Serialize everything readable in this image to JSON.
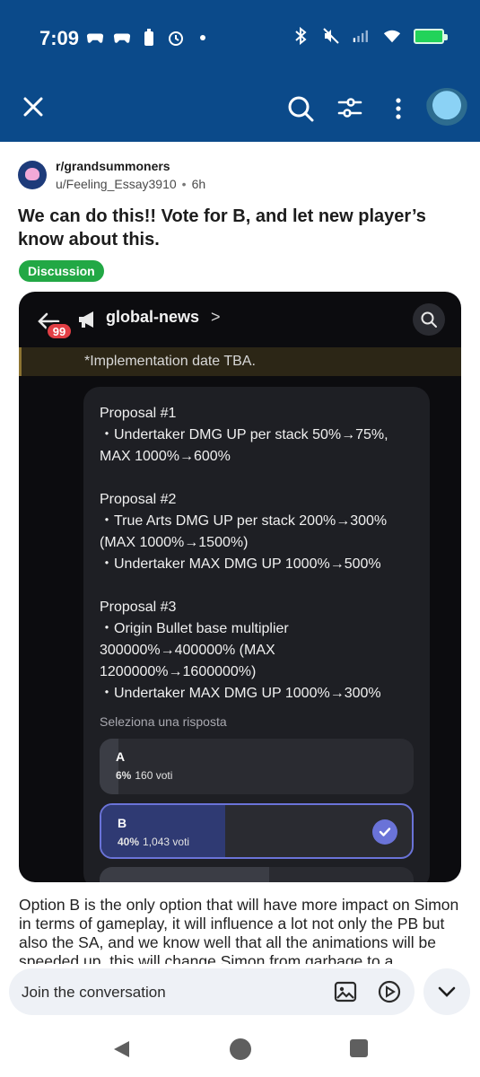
{
  "status_bar": {
    "time": "7:09",
    "left_icons": [
      "game-controller-icon",
      "game-controller-icon",
      "battery-saver-icon",
      "alarm-icon",
      "dot-icon"
    ],
    "right_icons": [
      "bluetooth-icon",
      "mute-icon",
      "signal-icon",
      "wifi-icon",
      "battery-charging-icon"
    ]
  },
  "app_bar": {
    "icons": [
      "close-icon",
      "search-icon",
      "filter-icon",
      "more-vertical-icon",
      "profile-avatar"
    ]
  },
  "post": {
    "subreddit": "r/grandsummoners",
    "author": "u/Feeling_Essay3910",
    "separator": "•",
    "age": "6h",
    "title": "We can do this!! Vote for B, and let new player’s know about this.",
    "flair": "Discussion",
    "body": "Option B is the only option that will have more impact on Simon in terms of gameplay, it will influence a lot not only the PB but also the SA, and we know well that all the animations will be speeded up, this will change Simon from garbage to a"
  },
  "screenshot": {
    "channel": "global-news",
    "channel_chevron": ">",
    "badge_count": "99",
    "implementation": "*Implementation date TBA.",
    "proposals": [
      {
        "title": "Proposal #1",
        "lines": [
          "・Undertaker DMG UP per stack 50%→75%, MAX 1000%→600%"
        ]
      },
      {
        "title": "Proposal #2",
        "lines": [
          "・True Arts DMG UP per stack 200%→300% (MAX 1000%→1500%)",
          "・Undertaker MAX DMG UP 1000%→500%"
        ]
      },
      {
        "title": "Proposal #3",
        "lines": [
          "・Origin Bullet base multiplier 300000%→400000% (MAX 1200000%→1600000%)",
          "・Undertaker MAX DMG UP 1000%→300%"
        ]
      }
    ],
    "select_label": "Seleziona una risposta",
    "options": [
      {
        "letter": "A",
        "percent_label": "6%",
        "votes": "160 voti",
        "fill_fraction": 0.06,
        "selected": false
      },
      {
        "letter": "B",
        "percent_label": "40%",
        "votes": "1,043 voti",
        "fill_fraction": 0.4,
        "selected": true
      },
      {
        "letter": "",
        "percent_label": "",
        "votes": "",
        "fill_fraction": 0.54,
        "selected": false
      }
    ]
  },
  "composer": {
    "placeholder": "Join the conversation",
    "icons": [
      "image-icon",
      "video-icon"
    ],
    "expand_icon": "chevron-down-icon"
  },
  "nav_bar": {
    "icons": [
      "back-triangle-icon",
      "home-circle-icon",
      "recents-square-icon"
    ]
  },
  "colors": {
    "app_bar": "#0b4a8a",
    "flair": "#22a845",
    "discord_bg": "#0c0c0f",
    "poll_bg": "#1e1f24",
    "selected_border": "#6a73d8",
    "badge": "#e23f45"
  }
}
